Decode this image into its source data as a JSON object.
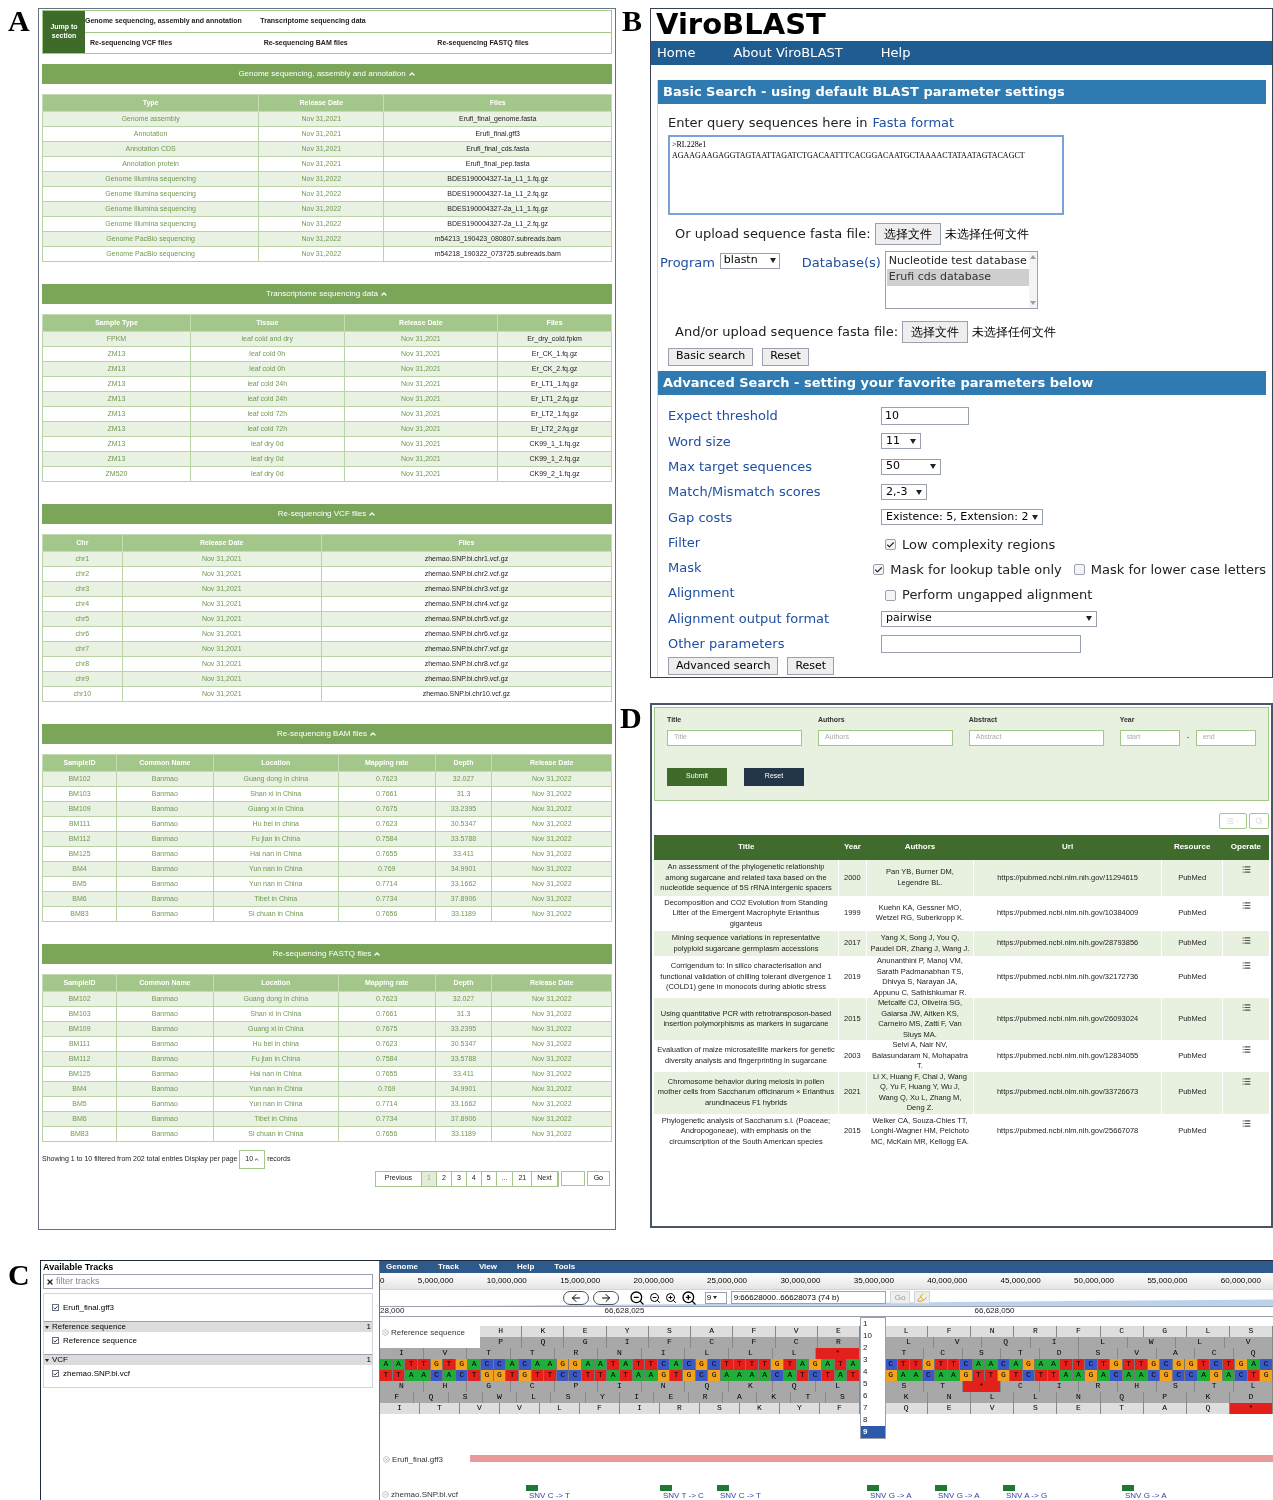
{
  "panel_a": {
    "label": "A",
    "jump": {
      "label": "Jump to section",
      "rows": [
        [
          "Genome sequencing, assembly and annotation",
          "Transcriptome sequencing data"
        ],
        [
          "Re-sequencing VCF files",
          "Re-sequencing BAM files",
          "Re-sequencing FASTQ files"
        ]
      ]
    },
    "sections": [
      {
        "title": "Genome sequencing, assembly and annotation",
        "columns": [
          "Type",
          "Release Date",
          "Files"
        ],
        "rows": [
          [
            "Genome assembly",
            "Nov 31,2021",
            "Erufi_final_genome.fasta"
          ],
          [
            "Annotation",
            "Nov 31,2021",
            "Erufi_final.gff3"
          ],
          [
            "Annotation CDS",
            "Nov 31,2021",
            "Erufi_final_cds.fasta"
          ],
          [
            "Annotation protein",
            "Nov 31,2021",
            "Erufi_final_pep.fasta"
          ],
          [
            "Genome Illumina sequencing",
            "Nov 31,2022",
            "BDES190004327-1a_L1_1.fq.gz"
          ],
          [
            "Genome Illumina sequencing",
            "Nov 31,2022",
            "BDES190004327-1a_L1_2.fq.gz"
          ],
          [
            "Genome Illumina sequencing",
            "Nov 31,2022",
            "BDES190004327-2a_L1_1.fq.gz"
          ],
          [
            "Genome Illumina sequencing",
            "Nov 31,2022",
            "BDES190004327-2a_L1_2.fq.gz"
          ],
          [
            "Genome PacBio sequencing",
            "Nov 31,2022",
            "m54213_190423_080807.subreads.bam"
          ],
          [
            "Genome PacBio sequencing",
            "Nov 31,2022",
            "m54218_190322_073725.subreads.bam"
          ]
        ]
      },
      {
        "title": "Transcriptome sequencing data",
        "columns": [
          "Sample Type",
          "Tissue",
          "Release Date",
          "Files"
        ],
        "rows": [
          [
            "FPKM",
            "leaf cold and dry",
            "Nov 31,2021",
            "Er_dry_cold.fpkm"
          ],
          [
            "ZM13",
            "leaf cold 0h",
            "Nov 31,2021",
            "Er_CK_1.fq.gz"
          ],
          [
            "ZM13",
            "leaf cold 0h",
            "Nov 31,2021",
            "Er_CK_2.fq.gz"
          ],
          [
            "ZM13",
            "leaf cold 24h",
            "Nov 31,2021",
            "Er_LT1_1.fq.gz"
          ],
          [
            "ZM13",
            "leaf cold 24h",
            "Nov 31,2021",
            "Er_LT1_2.fq.gz"
          ],
          [
            "ZM13",
            "leaf cold 72h",
            "Nov 31,2021",
            "Er_LT2_1.fq.gz"
          ],
          [
            "ZM13",
            "leaf cold 72h",
            "Nov 31,2021",
            "Er_LT2_2.fq.gz"
          ],
          [
            "ZM13",
            "leaf dry 0d",
            "Nov 31,2021",
            "CK99_1_1.fq.gz"
          ],
          [
            "ZM13",
            "leaf dry 0d",
            "Nov 31,2021",
            "CK99_1_2.fq.gz"
          ],
          [
            "ZM520",
            "leaf dry 0d",
            "Nov 31,2021",
            "CK99_2_1.fq.gz"
          ]
        ]
      },
      {
        "title": "Re-sequencing VCF files",
        "columns": [
          "Chr",
          "Release Date",
          "Files"
        ],
        "rows": [
          [
            "chr1",
            "Nov 31,2021",
            "zhemao.SNP.bi.chr1.vcf.gz"
          ],
          [
            "chr2",
            "Nov 31,2021",
            "zhemao.SNP.bi.chr2.vcf.gz"
          ],
          [
            "chr3",
            "Nov 31,2021",
            "zhemao.SNP.bi.chr3.vcf.gz"
          ],
          [
            "chr4",
            "Nov 31,2021",
            "zhemao.SNP.bi.chr4.vcf.gz"
          ],
          [
            "chr5",
            "Nov 31,2021",
            "zhemao.SNP.bi.chr5.vcf.gz"
          ],
          [
            "chr6",
            "Nov 31,2021",
            "zhemao.SNP.bi.chr6.vcf.gz"
          ],
          [
            "chr7",
            "Nov 31,2021",
            "zhemao.SNP.bi.chr7.vcf.gz"
          ],
          [
            "chr8",
            "Nov 31,2021",
            "zhemao.SNP.bi.chr8.vcf.gz"
          ],
          [
            "chr9",
            "Nov 31,2021",
            "zhemao.SNP.bi.chr9.vcf.gz"
          ],
          [
            "chr10",
            "Nov 31,2021",
            "zhemao.SNP.bi.chr10.vcf.gz"
          ]
        ]
      },
      {
        "title": "Re-sequencing BAM files",
        "columns": [
          "SampleID",
          "Common Name",
          "Location",
          "Mapping rate",
          "Depth",
          "Release Date"
        ],
        "rows": [
          [
            "BM102",
            "Banmao",
            "Guang dong in china",
            "0.7623",
            "32.027",
            "Nov 31,2022"
          ],
          [
            "BM103",
            "Banmao",
            "Shan xi in China",
            "0.7661",
            "31.3",
            "Nov 31,2022"
          ],
          [
            "BM109",
            "Banmao",
            "Guang xi in China",
            "0.7675",
            "33.2395",
            "Nov 31,2022"
          ],
          [
            "BM111",
            "Banmao",
            "Hu bei in china",
            "0.7623",
            "30.5347",
            "Nov 31,2022"
          ],
          [
            "BM112",
            "Banmao",
            "Fu jian in China",
            "0.7584",
            "33.5788",
            "Nov 31,2022"
          ],
          [
            "BM125",
            "Banmao",
            "Hai nan in China",
            "0.7655",
            "33.411",
            "Nov 31,2022"
          ],
          [
            "BM4",
            "Banmao",
            "Yun nan in China",
            "0.769",
            "34.9901",
            "Nov 31,2022"
          ],
          [
            "BM5",
            "Banmao",
            "Yun nan in China",
            "0.7714",
            "33.1662",
            "Nov 31,2022"
          ],
          [
            "BM6",
            "Banmao",
            "Tibet in China",
            "0.7734",
            "37.8906",
            "Nov 31,2022"
          ],
          [
            "BM83",
            "Banmao",
            "Si chuan in China",
            "0.7656",
            "33.1189",
            "Nov 31,2022"
          ]
        ]
      },
      {
        "title": "Re-sequencing FASTQ files",
        "columns": [
          "SampleID",
          "Common Name",
          "Location",
          "Mapping rate",
          "Depth",
          "Release Date"
        ],
        "rows": [
          [
            "BM102",
            "Banmao",
            "Guang dong in china",
            "0.7623",
            "32.027",
            "Nov 31,2022"
          ],
          [
            "BM103",
            "Banmao",
            "Shan xi in China",
            "0.7661",
            "31.3",
            "Nov 31,2022"
          ],
          [
            "BM109",
            "Banmao",
            "Guang xi in China",
            "0.7675",
            "33.2395",
            "Nov 31,2022"
          ],
          [
            "BM111",
            "Banmao",
            "Hu bei in china",
            "0.7623",
            "30.5347",
            "Nov 31,2022"
          ],
          [
            "BM112",
            "Banmao",
            "Fu jian in China",
            "0.7584",
            "33.5788",
            "Nov 31,2022"
          ],
          [
            "BM125",
            "Banmao",
            "Hai nan in China",
            "0.7655",
            "33.411",
            "Nov 31,2022"
          ],
          [
            "BM4",
            "Banmao",
            "Yun nan in China",
            "0.769",
            "34.9901",
            "Nov 31,2022"
          ],
          [
            "BM5",
            "Banmao",
            "Yun nan in China",
            "0.7714",
            "33.1662",
            "Nov 31,2022"
          ],
          [
            "BM6",
            "Banmao",
            "Tibet in China",
            "0.7734",
            "37.8906",
            "Nov 31,2022"
          ],
          [
            "BM83",
            "Banmao",
            "Si chuan in China",
            "0.7656",
            "33.1189",
            "Nov 31,2022"
          ]
        ]
      }
    ],
    "footer": {
      "summary": "Showing 1 to 10 filtered from 202 total entries Display per page",
      "per_page": "10",
      "records": "records",
      "pages": [
        {
          "label": "Previous",
          "selected": false
        },
        {
          "label": "1",
          "selected": true
        },
        {
          "label": "2",
          "selected": false
        },
        {
          "label": "3",
          "selected": false
        },
        {
          "label": "4",
          "selected": false
        },
        {
          "label": "5",
          "selected": false
        },
        {
          "label": "...",
          "selected": false
        },
        {
          "label": "21",
          "selected": false
        },
        {
          "label": "Next",
          "selected": false
        }
      ],
      "go": "Go"
    }
  },
  "panel_b": {
    "label": "B",
    "logo": "ViroBLAST",
    "nav": [
      "Home",
      "About ViroBLAST",
      "Help"
    ],
    "basic": {
      "title": "Basic Search - using default BLAST parameter settings",
      "query_label": "Enter query sequences here in",
      "query_link": "Fasta format",
      "query_lines": [
        ">RL228e1",
        "AGAAGAAGAGGTAGTAATTAGATCTGACAATTTCACGGACAATGCTAAAACTATAATAGTACAGCT"
      ],
      "upload": {
        "label": "Or upload sequence fasta file:",
        "button": "选择文件",
        "status": "未选择任何文件"
      },
      "program": {
        "label": "Program",
        "value": "blastn"
      },
      "database": {
        "label": "Database(s)",
        "options": [
          {
            "label": "Nucleotide test database",
            "selected": false
          },
          {
            "label": "Erufi cds database",
            "selected": true
          }
        ]
      },
      "upload2": {
        "label": "And/or upload sequence fasta file:",
        "button": "选择文件",
        "status": "未选择任何文件"
      },
      "buttons": [
        "Basic search",
        "Reset"
      ]
    },
    "advanced": {
      "title": "Advanced Search - setting your favorite parameters below",
      "params": [
        {
          "label": "Expect threshold",
          "kind": "text",
          "value": "10"
        },
        {
          "label": "Word size",
          "kind": "select",
          "value": "11"
        },
        {
          "label": "Max target sequences",
          "kind": "select",
          "value": "50"
        },
        {
          "label": "Match/Mismatch scores",
          "kind": "select",
          "value": "2,-3"
        },
        {
          "label": "Gap costs",
          "kind": "select",
          "value": "Existence: 5, Extension: 2"
        },
        {
          "label": "Filter",
          "kind": "checks",
          "options": [
            {
              "label": "Low complexity regions",
              "checked": true
            }
          ]
        },
        {
          "label": "Mask",
          "kind": "checks",
          "options": [
            {
              "label": "Mask for lookup table only",
              "checked": true
            },
            {
              "label": "Mask for lower case letters",
              "checked": false
            }
          ]
        },
        {
          "label": "Alignment",
          "kind": "checks",
          "options": [
            {
              "label": "Perform ungapped alignment",
              "checked": false
            }
          ]
        },
        {
          "label": "Alignment output format",
          "kind": "select",
          "value": "pairwise"
        },
        {
          "label": "Other parameters",
          "kind": "text"
        }
      ],
      "buttons": [
        "Advanced search",
        "Reset"
      ]
    }
  },
  "panel_d": {
    "label": "D",
    "filters": [
      {
        "label": "Title",
        "placeholder": "Title"
      },
      {
        "label": "Authors",
        "placeholder": "Authors"
      },
      {
        "label": "Abstract",
        "placeholder": "Abstract"
      }
    ],
    "year": {
      "label": "Year",
      "start": "start",
      "separator": "-",
      "end": "end"
    },
    "buttons": [
      {
        "label": "Submit",
        "kind": "submit"
      },
      {
        "label": "Reset",
        "kind": "reset"
      }
    ],
    "columns": [
      "Title",
      "Year",
      "Authors",
      "Url",
      "Resource",
      "Operate"
    ],
    "rows": [
      {
        "title": "An assessment of the phylogenetic relationship among sugarcane and related taxa based on the nucleotide sequence of 5S rRNA intergenic spacers",
        "year": "2000",
        "authors": "Pan YB, Burner DM, Legendre BL.",
        "url": "https://pubmed.ncbi.nlm.nih.gov/11294615",
        "resource": "PubMed"
      },
      {
        "title": "Decomposition and CO2 Evolution from Standing Litter of the Emergent Macrophyte Erianthus giganteus",
        "year": "1999",
        "authors": "Kuehn KA, Gessner MO, Wetzel RG, Suberkropp K.",
        "url": "https://pubmed.ncbi.nlm.nih.gov/10384009",
        "resource": "PubMed"
      },
      {
        "title": "Mining sequence variations in representative polyploid sugarcane germplasm accessions",
        "year": "2017",
        "authors": "Yang X, Song J, You Q, Paudel DR, Zhang J, Wang J.",
        "url": "https://pubmed.ncbi.nlm.nih.gov/28793856",
        "resource": "PubMed"
      },
      {
        "title": "Corrigendum to: In silico characterisation and functional validation of chilling tolerant divergence 1 (COLD1) gene in monocots during abiotic stress",
        "year": "2019",
        "authors": "Anunanthini P, Manoj VM, Sarath Padmanabhan TS, Dhivya S, Narayan JA, Appunu C, Sathishkumar R.",
        "url": "https://pubmed.ncbi.nlm.nih.gov/32172736",
        "resource": "PubMed"
      },
      {
        "title": "Using quantitative PCR with retrotransposon-based insertion polymorphisms as markers in sugarcane",
        "year": "2015",
        "authors": "Metcalfe CJ, Oliveira SG, Gaiarsa JW, Aitken KS, Carneiro MS, Zatti F, Van Sluys MA.",
        "url": "https://pubmed.ncbi.nlm.nih.gov/26093024",
        "resource": "PubMed"
      },
      {
        "title": "Evaluation of maize microsatellite markers for genetic diversity analysis and fingerprinting in sugarcane",
        "year": "2003",
        "authors": "Selvi A, Nair NV, Balasundaram N, Mohapatra T.",
        "url": "https://pubmed.ncbi.nlm.nih.gov/12834055",
        "resource": "PubMed"
      },
      {
        "title": "Chromosome behavior during meiosis in pollen mother cells from Saccharum officinarum × Erianthus arundinaceus F1 hybrids",
        "year": "2021",
        "authors": "Li X, Huang F, Chai J, Wang Q, Yu F, Huang Y, Wu J, Wang Q, Xu L, Zhang M, Deng Z.",
        "url": "https://pubmed.ncbi.nlm.nih.gov/33726673",
        "resource": "PubMed"
      },
      {
        "title": "Phylogenetic analysis of Saccharum s.l. (Poaceae; Andropogoneae), with emphasis on the circumscription of the South American species",
        "year": "2015",
        "authors": "Welker CA, Souza-Chies TT, Longhi-Wagner HM, Peichoto MC, McKain MR, Kellogg EA.",
        "url": "https://pubmed.ncbi.nlm.nih.gov/25667078",
        "resource": "PubMed"
      }
    ]
  },
  "panel_c": {
    "label": "C",
    "sidebar": {
      "title": "Available Tracks",
      "filter_placeholder": "filter tracks",
      "items": [
        {
          "kind": "track",
          "label": "Erufi_final.gff3",
          "checked": true
        },
        {
          "kind": "category",
          "label": "Reference sequence",
          "count": "1",
          "expanded": true
        },
        {
          "kind": "track",
          "label": "Reference sequence",
          "checked": true
        },
        {
          "kind": "category",
          "label": "VCF",
          "count": "1",
          "expanded": true
        },
        {
          "kind": "track",
          "label": "zhemao.SNP.bi.vcf",
          "checked": true
        }
      ]
    },
    "menu": [
      "Genome",
      "Track",
      "View",
      "Help",
      "Tools"
    ],
    "ruler": [
      "0",
      "5,000,000",
      "10,000,000",
      "15,000,000",
      "20,000,000",
      "25,000,000",
      "30,000,000",
      "35,000,000",
      "40,000,000",
      "45,000,000",
      "50,000,000",
      "55,000,000",
      "60,000,000"
    ],
    "chromosome": "9",
    "location": "9:66628000..66628073 (74 b)",
    "go": "Go",
    "chromosome_options": [
      {
        "label": "1",
        "selected": false
      },
      {
        "label": "10",
        "selected": false
      },
      {
        "label": "2",
        "selected": false
      },
      {
        "label": "3",
        "selected": false
      },
      {
        "label": "4",
        "selected": false
      },
      {
        "label": "5",
        "selected": false
      },
      {
        "label": "6",
        "selected": false
      },
      {
        "label": "7",
        "selected": false
      },
      {
        "label": "8",
        "selected": false
      },
      {
        "label": "9",
        "selected": true
      }
    ],
    "detail_ruler": [
      "28,000",
      "66,628,025",
      "66,628,050"
    ],
    "reference_label": "Reference sequence",
    "sequence_rows": [
      {
        "kind": "aa",
        "left": [
          "H",
          "K",
          "E",
          "Y",
          "S",
          "A",
          "F",
          "V",
          "E"
        ],
        "right": [
          "L",
          "F",
          "N",
          "R",
          "F",
          "C",
          "G",
          "L",
          "S"
        ]
      },
      {
        "kind": "aa",
        "left": [
          "P",
          "Q",
          "G",
          "I",
          "F",
          "C",
          "F",
          "C",
          "R"
        ],
        "right": [
          "L",
          "V",
          "Q",
          "I",
          "L",
          "W",
          "L",
          "V"
        ]
      },
      {
        "kind": "aa",
        "left": [
          "I",
          "V",
          "T",
          "T",
          "R",
          "N",
          "I",
          "L",
          "L",
          "L",
          {
            "t": "*",
            "stop": true
          }
        ],
        "right": [
          "T",
          "C",
          "S",
          "T",
          "D",
          "S",
          "V",
          "A",
          "C",
          "Q"
        ]
      },
      {
        "kind": "bases",
        "left": [
          "A",
          "A",
          "T",
          "T",
          "G",
          "T",
          "G",
          "A",
          "C",
          "C",
          "A",
          "C",
          "A",
          "A",
          "G",
          "G",
          "A",
          "A",
          "T",
          "A",
          "T",
          "T",
          "C",
          "A",
          "C",
          "G",
          "C",
          "T",
          "T",
          "T",
          "T",
          "G",
          "T",
          "A",
          "G",
          "A",
          "T",
          "A"
        ],
        "right": [
          "C",
          "T",
          "T",
          "G",
          "T",
          "T",
          "C",
          "A",
          "A",
          "C",
          "A",
          "G",
          "A",
          "A",
          "T",
          "T",
          "C",
          "T",
          "G",
          "T",
          "T",
          "G",
          "C",
          "G",
          "G",
          "T",
          "C",
          "T",
          "G",
          "A",
          "C"
        ]
      },
      {
        "kind": "bases",
        "left": [
          "T",
          "T",
          "A",
          "A",
          "C",
          "A",
          "C",
          "T",
          "G",
          "G",
          "T",
          "G",
          "T",
          "T",
          "C",
          "C",
          "T",
          "T",
          "A",
          "T",
          "A",
          "A",
          "G",
          "T",
          "G",
          "C",
          "G",
          "A",
          "A",
          "A",
          "A",
          "C",
          "A",
          "T",
          "C",
          "T",
          "A",
          "T"
        ],
        "right": [
          "G",
          "A",
          "A",
          "C",
          "A",
          "A",
          "G",
          "T",
          "T",
          "G",
          "T",
          "C",
          "T",
          "T",
          "A",
          "A",
          "G",
          "A",
          "C",
          "A",
          "A",
          "C",
          "G",
          "C",
          "C",
          "A",
          "G",
          "A",
          "C",
          "T",
          "G"
        ]
      },
      {
        "kind": "aa",
        "left": [
          "N",
          "H",
          "G",
          "C",
          "P",
          "I",
          "N",
          "Q",
          "K",
          "Q",
          "L"
        ],
        "right": [
          "S",
          "T",
          {
            "t": "*",
            "stop": true
          },
          "C",
          "I",
          "R",
          "H",
          "S",
          "T",
          "L"
        ]
      },
      {
        "kind": "aa",
        "left": [
          "F",
          "Q",
          "S",
          "W",
          "L",
          "S",
          "Y",
          "I",
          "E",
          "R",
          "A",
          "K",
          "T",
          "S"
        ],
        "right": [
          "K",
          "N",
          "L",
          "L",
          "N",
          "Q",
          "P",
          "K",
          "D"
        ]
      },
      {
        "kind": "aa",
        "left": [
          "I",
          "T",
          "V",
          "V",
          "L",
          "F",
          "I",
          "R",
          "S",
          "K",
          "Y",
          "F"
        ],
        "right": [
          "Q",
          "E",
          "V",
          "S",
          "E",
          "T",
          "A",
          "Q",
          {
            "t": "*",
            "stop": true
          }
        ]
      }
    ],
    "gff_label": "Erufi_final.gff3",
    "vcf_label": "zhemao.SNP.bi.vcf",
    "variants": [
      "SNV C -> T",
      "SNV T -> C",
      "SNV C -> T",
      "SNV G -> A",
      "SNV G -> A",
      "SNV A -> G",
      "SNV G -> A"
    ]
  }
}
